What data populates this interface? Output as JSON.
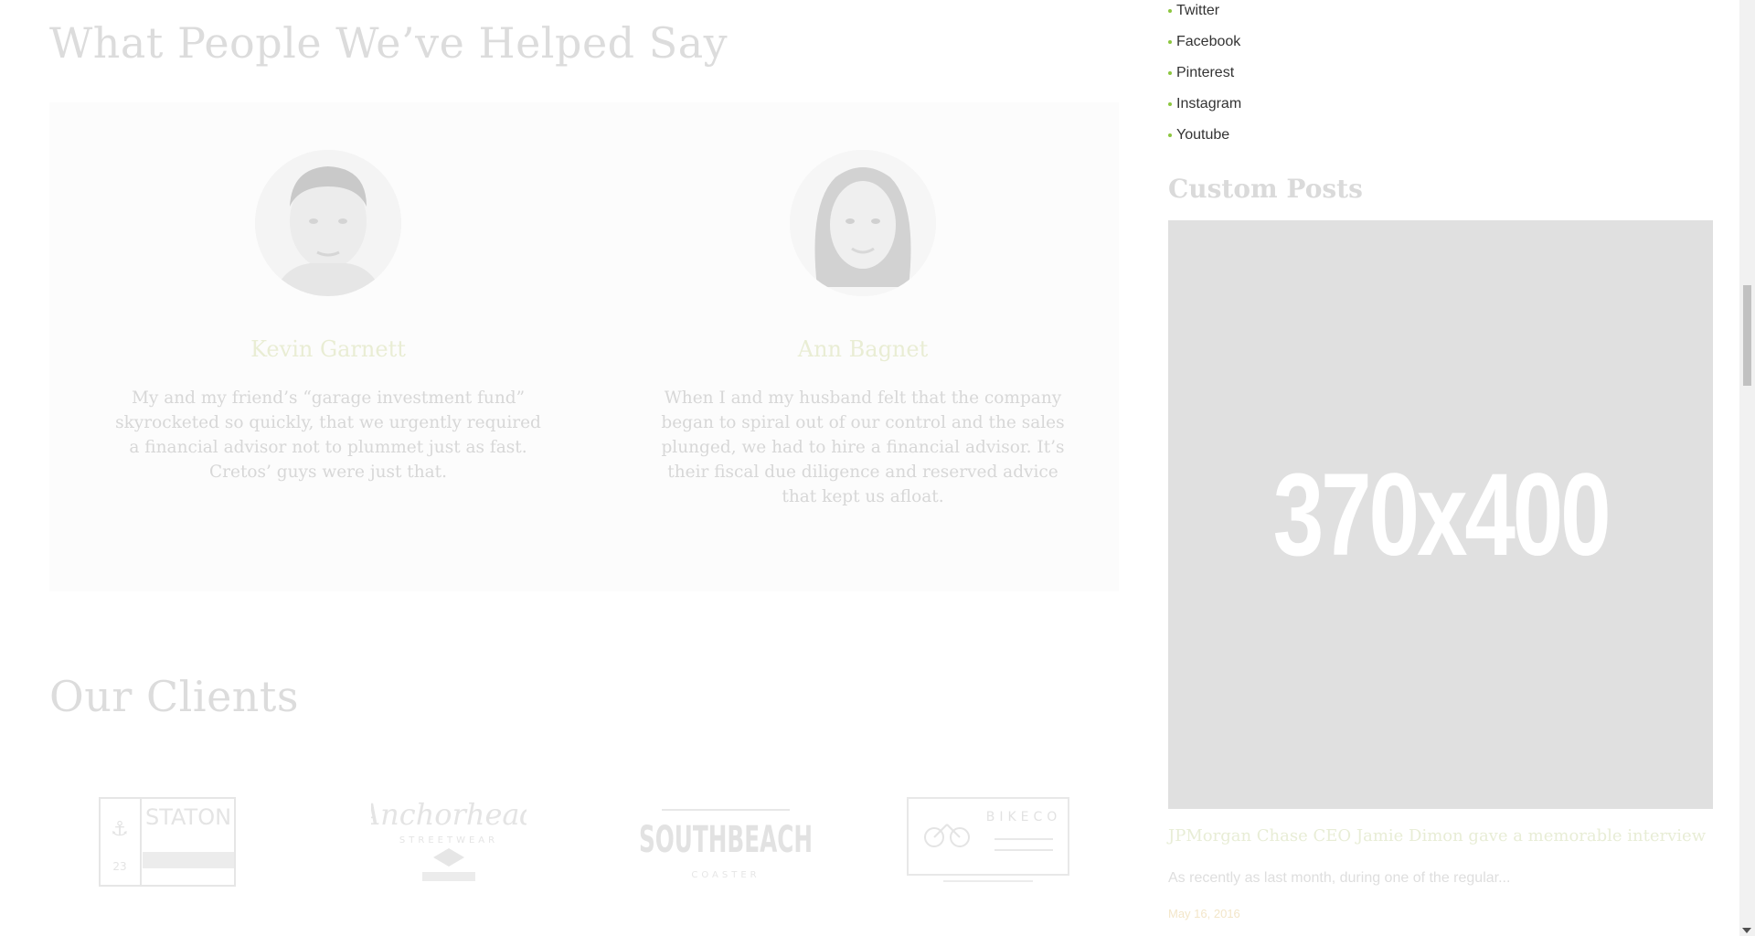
{
  "testimonials_section": {
    "title": "What People We’ve Helped Say",
    "items": [
      {
        "name": "Kevin Garnett",
        "quote": "My and my friend’s “garage investment fund” skyrocketed so quickly, that we urgently required a financial advisor not to plummet just as fast. Cretos’ guys were just that."
      },
      {
        "name": "Ann Bagnet",
        "quote": "When I and my husband felt that the company began to spiral out of our control and the sales plunged, we had to hire a financial advisor. It’s their fiscal due diligence and reserved advice that kept us afloat."
      }
    ]
  },
  "clients_section": {
    "title": "Our Clients",
    "logos": [
      {
        "name": "STATON",
        "number": "23"
      },
      {
        "name": "Anchorhead",
        "sub": "STREETWEAR"
      },
      {
        "name": "SOUTHBEACH",
        "sub": "COASTER"
      },
      {
        "name": "BIKECO"
      }
    ]
  },
  "sidebar": {
    "social_links": [
      "Twitter",
      "Facebook",
      "Pinterest",
      "Instagram",
      "Youtube"
    ],
    "custom_posts_title": "Custom Posts",
    "post": {
      "image_placeholder": "370x400",
      "title": "JPMorgan Chase CEO Jamie Dimon gave a memorable interview",
      "excerpt": "As recently as last month, during one of the regular...",
      "date": "May 16, 2016"
    }
  },
  "colors": {
    "bullet": "#8cc63f",
    "placeholder_bg": "#e0e0e0"
  }
}
